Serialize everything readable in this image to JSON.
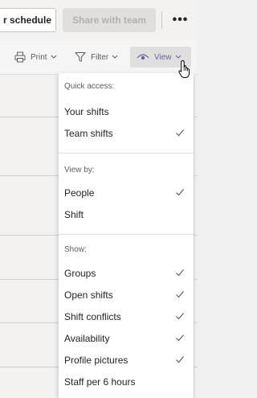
{
  "toolbar": {
    "schedule_label": "r schedule",
    "share_label": "Share with team",
    "more_label": "•••"
  },
  "commands": {
    "print_label": "Print",
    "filter_label": "Filter",
    "view_label": "View"
  },
  "menu": {
    "quick_access": {
      "header": "Quick access:",
      "items": [
        {
          "label": "Your shifts",
          "checked": false
        },
        {
          "label": "Team shifts",
          "checked": true
        }
      ]
    },
    "view_by": {
      "header": "View by:",
      "items": [
        {
          "label": "People",
          "checked": true
        },
        {
          "label": "Shift",
          "checked": false
        }
      ]
    },
    "show": {
      "header": "Show:",
      "items": [
        {
          "label": "Groups",
          "checked": true
        },
        {
          "label": "Open shifts",
          "checked": true
        },
        {
          "label": "Shift conflicts",
          "checked": true
        },
        {
          "label": "Availability",
          "checked": true
        },
        {
          "label": "Profile pictures",
          "checked": true
        },
        {
          "label": "Staff per 6 hours",
          "checked": false
        }
      ]
    }
  },
  "colors": {
    "accent": "#6264a7",
    "checkmark": "#605e5c"
  },
  "icons": {
    "print": "printer-icon",
    "filter": "funnel-icon",
    "view": "eye-icon",
    "check": "checkmark-icon",
    "more": "more-icon",
    "cursor": "hand-cursor"
  }
}
